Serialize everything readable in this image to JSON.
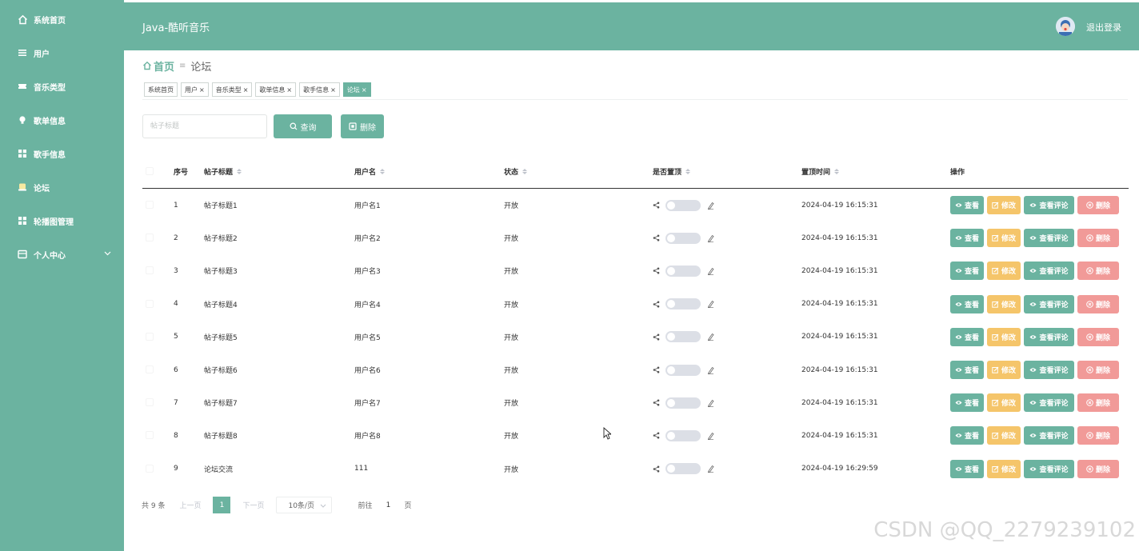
{
  "sidebar": {
    "items": [
      {
        "label": "系统首页",
        "icon": "home-icon"
      },
      {
        "label": "用户",
        "icon": "list-icon"
      },
      {
        "label": "音乐类型",
        "icon": "ticket-icon"
      },
      {
        "label": "歌单信息",
        "icon": "bulb-icon"
      },
      {
        "label": "歌手信息",
        "icon": "grid-icon"
      },
      {
        "label": "论坛",
        "icon": "chat-icon"
      },
      {
        "label": "轮播图管理",
        "icon": "grid-icon"
      },
      {
        "label": "个人中心",
        "icon": "card-icon"
      }
    ]
  },
  "header": {
    "title": "Java-酷听音乐",
    "logout": "退出登录"
  },
  "breadcrumb": {
    "home": "首页",
    "current": "论坛"
  },
  "tags": [
    {
      "label": "系统首页",
      "closable": false,
      "active": false
    },
    {
      "label": "用户",
      "closable": true,
      "active": false
    },
    {
      "label": "音乐类型",
      "closable": true,
      "active": false
    },
    {
      "label": "歌单信息",
      "closable": true,
      "active": false
    },
    {
      "label": "歌手信息",
      "closable": true,
      "active": false
    },
    {
      "label": "论坛",
      "closable": true,
      "active": true
    }
  ],
  "search": {
    "placeholder": "帖子标题",
    "query_label": "查询",
    "delete_label": "删除"
  },
  "table": {
    "columns": [
      "序号",
      "帖子标题",
      "用户名",
      "状态",
      "是否置顶",
      "置顶时间",
      "操作"
    ],
    "rows": [
      {
        "index": "1",
        "title": "帖子标题1",
        "user": "用户名1",
        "status": "开放",
        "top": false,
        "time": "2024-04-19 16:15:31"
      },
      {
        "index": "2",
        "title": "帖子标题2",
        "user": "用户名2",
        "status": "开放",
        "top": false,
        "time": "2024-04-19 16:15:31"
      },
      {
        "index": "3",
        "title": "帖子标题3",
        "user": "用户名3",
        "status": "开放",
        "top": false,
        "time": "2024-04-19 16:15:31"
      },
      {
        "index": "4",
        "title": "帖子标题4",
        "user": "用户名4",
        "status": "开放",
        "top": false,
        "time": "2024-04-19 16:15:31"
      },
      {
        "index": "5",
        "title": "帖子标题5",
        "user": "用户名5",
        "status": "开放",
        "top": false,
        "time": "2024-04-19 16:15:31"
      },
      {
        "index": "6",
        "title": "帖子标题6",
        "user": "用户名6",
        "status": "开放",
        "top": false,
        "time": "2024-04-19 16:15:31"
      },
      {
        "index": "7",
        "title": "帖子标题7",
        "user": "用户名7",
        "status": "开放",
        "top": false,
        "time": "2024-04-19 16:15:31"
      },
      {
        "index": "8",
        "title": "帖子标题8",
        "user": "用户名8",
        "status": "开放",
        "top": false,
        "time": "2024-04-19 16:15:31"
      },
      {
        "index": "9",
        "title": "论坛交流",
        "user": "111",
        "status": "开放",
        "top": false,
        "time": "2024-04-19 16:29:59"
      }
    ],
    "actions": {
      "view": "查看",
      "edit": "修改",
      "comments": "查看评论",
      "delete": "删除"
    }
  },
  "pagination": {
    "total": "共 9 条",
    "prev": "上一页",
    "current_page": "1",
    "next": "下一页",
    "page_size": "10条/页",
    "goto_prefix": "前往",
    "goto_value": "1",
    "goto_suffix": "页"
  },
  "watermark": "CSDN @QQ_2279239102",
  "colors": {
    "primary": "#6bb3a0",
    "warning": "#f5c56a",
    "danger": "#f19a98"
  }
}
